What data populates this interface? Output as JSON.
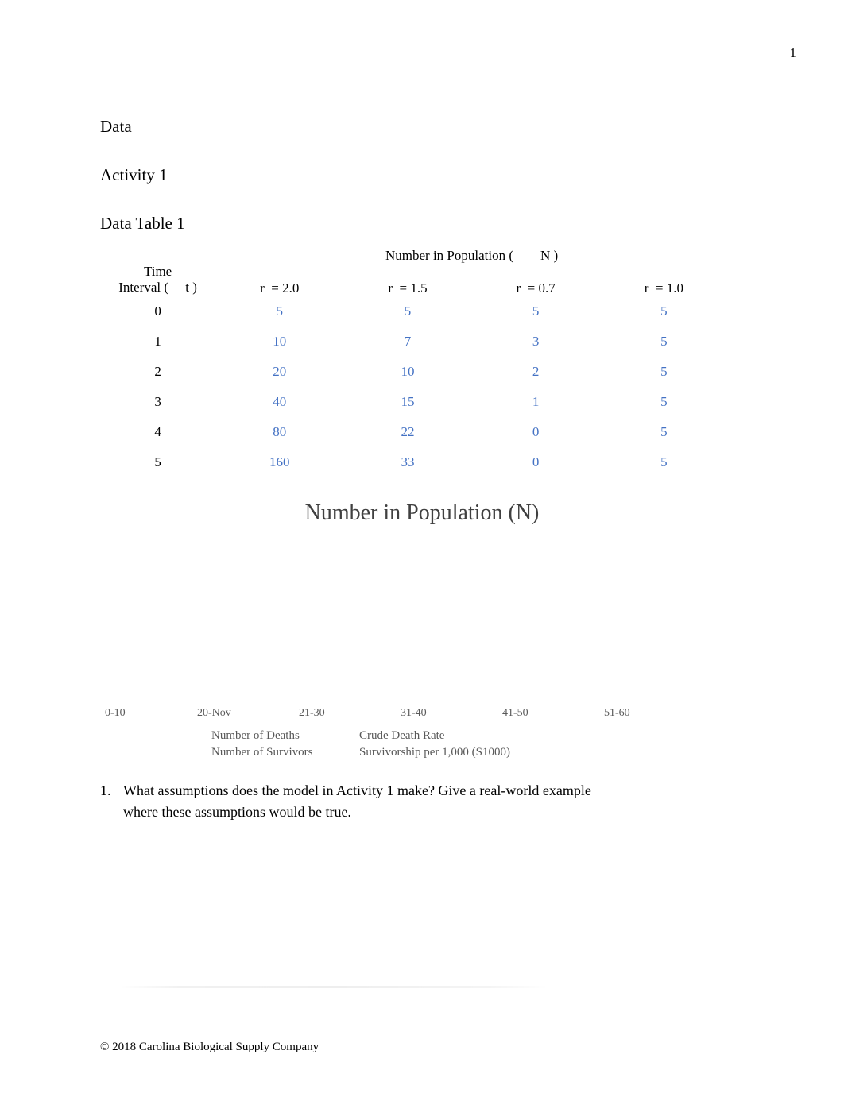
{
  "page": {
    "number": "1",
    "footer": "© 2018 Carolina Biological Supply Company"
  },
  "headings": {
    "data": "Data",
    "activity": "Activity 1",
    "data_table": "Data Table 1"
  },
  "table": {
    "span_header": "Number in Population (        N )",
    "time_header_line1": "Time",
    "time_header_line2": "Interval (     t )",
    "column_headers": [
      "r  = 2.0",
      "r  = 1.5",
      "r  = 0.7",
      "r  = 1.0"
    ],
    "rows": [
      {
        "t": "0",
        "values": [
          "5",
          "5",
          "5",
          "5"
        ]
      },
      {
        "t": "1",
        "values": [
          "10",
          "7",
          "3",
          "5"
        ]
      },
      {
        "t": "2",
        "values": [
          "20",
          "10",
          "2",
          "5"
        ]
      },
      {
        "t": "3",
        "values": [
          "40",
          "15",
          "1",
          "5"
        ]
      },
      {
        "t": "4",
        "values": [
          "80",
          "22",
          "0",
          "5"
        ]
      },
      {
        "t": "5",
        "values": [
          "160",
          "33",
          "0",
          "5"
        ]
      }
    ]
  },
  "chart_data": {
    "type": "bar",
    "title": "Number in Population (N)",
    "xlabel": "",
    "ylabel": "",
    "grid": false,
    "legend_position": "bottom",
    "categories": [
      "0-10",
      "20-Nov",
      "21-30",
      "31-40",
      "41-50",
      "51-60"
    ],
    "series": [
      {
        "name": "Number of Deaths",
        "values": []
      },
      {
        "name": "Crude Death Rate",
        "values": []
      },
      {
        "name": "Number of Survivors",
        "values": []
      },
      {
        "name": "Survivorship per 1,000 (S1000)",
        "values": []
      }
    ],
    "legend_entries": [
      "Number of Deaths",
      "Crude Death Rate",
      "Number of Survivors",
      "Survivorship per 1,000 (S1000)"
    ],
    "note": "plot area rendered empty — no data series drawn"
  },
  "questions": [
    {
      "number": "1.",
      "text": "What assumptions does the model in Activity 1 make? Give a real-world example where these assumptions would be true."
    }
  ],
  "colors": {
    "value_blue": "#4472c4",
    "chart_title_gray": "#404040",
    "chart_label_gray": "#595959"
  }
}
